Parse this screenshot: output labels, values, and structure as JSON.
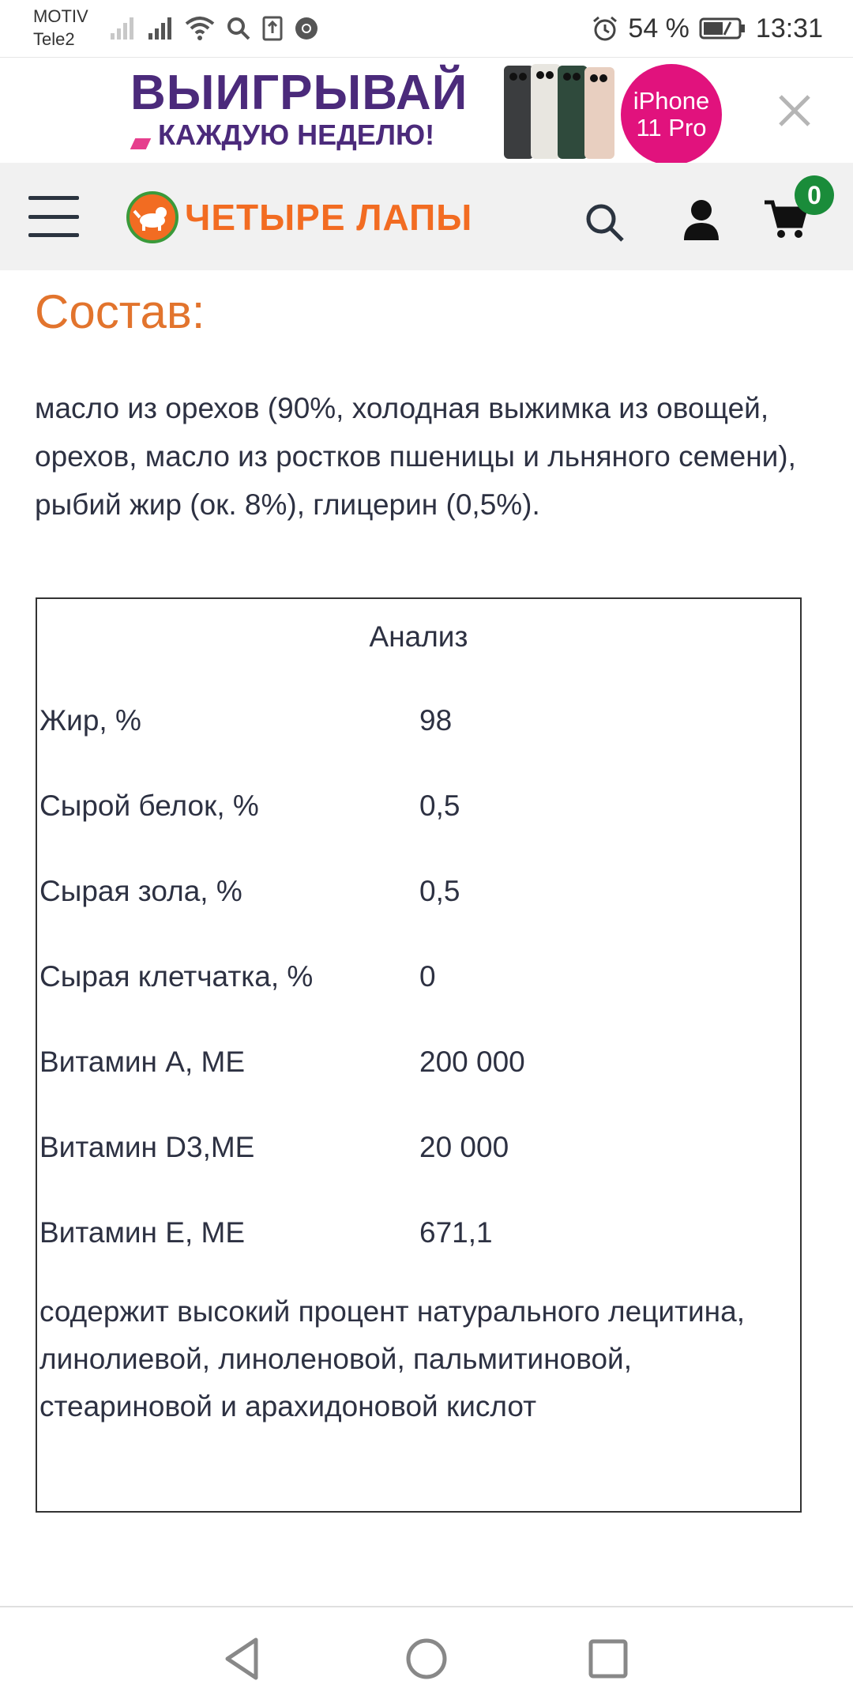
{
  "status_bar": {
    "carrier_line1": "MOTIV",
    "carrier_line2": "Tele2",
    "battery_percent": "54 %",
    "time": "13:31",
    "icons": [
      "signal-icon",
      "signal-icon",
      "wifi-icon",
      "search-icon",
      "download-icon",
      "chrome-icon",
      "alarm-icon",
      "battery-icon"
    ]
  },
  "ad": {
    "title": "ВЫИГРЫВАЙ",
    "subtitle": "КАЖДУЮ НЕДЕЛЮ!",
    "badge_line1": "iPhone",
    "badge_line2": "11 Pro",
    "brand_color": "#4b2a7b",
    "accent_color": "#e1127d"
  },
  "header": {
    "logo_text": "ЧЕТЫРЕ ЛАПЫ",
    "cart_count": "0",
    "logo_color": "#f26c22",
    "badge_color": "#1a8c3a"
  },
  "content": {
    "section_title": "Состав:",
    "composition": "масло из орехов (90%, холодная выжимка из овощей, орехов, масло из ростков пшеницы и льняного семени), рыбий жир (ок. 8%), глицерин (0,5%).",
    "table": {
      "caption": "Анализ",
      "rows": [
        {
          "label": "Жир, %",
          "value": "98"
        },
        {
          "label": "Сырой белок, %",
          "value": "0,5"
        },
        {
          "label": "Сырая зола, %",
          "value": "0,5"
        },
        {
          "label": "Сырая клетчатка, %",
          "value": "0"
        },
        {
          "label": "Витамин А, МЕ",
          "value": "200 000"
        },
        {
          "label": "Витамин D3,МЕ",
          "value": "20 000"
        },
        {
          "label": "Витамин Е, МЕ",
          "value": "671,1"
        }
      ],
      "note": "содержит высокий процент натурального лецитина, линолиевой, линоленовой, пальмитиновой, стеариновой и арахидоновой кислот"
    }
  }
}
